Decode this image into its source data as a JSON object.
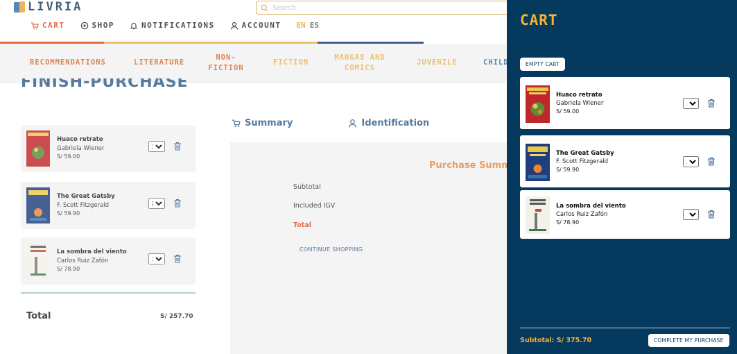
{
  "brand": {
    "logo_text": "LIVRIA"
  },
  "search": {
    "placeholder": "Search"
  },
  "nav": {
    "cart": "CART",
    "shop": "SHOP",
    "notifications": "NOTIFICATIONS",
    "account": "ACCOUNT",
    "lang_en": "EN",
    "lang_es": "ES"
  },
  "categories": [
    {
      "label": "RECOMMENDATIONS",
      "color": "#d9692a"
    },
    {
      "label": "LITERATURE",
      "color": "#d9692a"
    },
    {
      "label": "NON-\nFICTION",
      "color": "#d9692a"
    },
    {
      "label": "FICTION",
      "color": "#e8b24a"
    },
    {
      "label": "MANGAS AND\nCOMICS",
      "color": "#e8b24a"
    },
    {
      "label": "JUVENILE",
      "color": "#e8b24a"
    },
    {
      "label": "CHILDREN",
      "color": "#3a6f9e"
    }
  ],
  "checkout": {
    "title": "FINISH-PURCHASE",
    "items": [
      {
        "title": "Huaco retrato",
        "author": "Gabriela Wiener",
        "price": "S/ 59.00",
        "qty": "1"
      },
      {
        "title": "The Great Gatsby",
        "author": "F. Scott Fitzgerald",
        "price": "S/ 59.90",
        "qty": "2"
      },
      {
        "title": "La sombra del viento",
        "author": "Carlos Ruiz Zafón",
        "price": "S/ 78.90",
        "qty": "1"
      }
    ],
    "total_label": "Total",
    "total_value": "S/ 257.70",
    "tab_summary": "Summary",
    "tab_identification": "Identification",
    "summary_title": "Purchase Summary",
    "subtotal_label": "Subtotal",
    "igv_label": "Included IGV",
    "summary_total_label": "Total",
    "continue_shopping": "CONTINUE SHOPPING"
  },
  "cart": {
    "title": "CART",
    "empty_button": "EMPTY CART",
    "items": [
      {
        "title": "Huaco retrato",
        "author": "Gabriela Wiener",
        "price": "S/ 59.00",
        "qty": "3"
      },
      {
        "title": "The Great Gatsby",
        "author": "F. Scott Fitzgerald",
        "price": "S/ 59.90",
        "qty": "2"
      },
      {
        "title": "La sombra del viento",
        "author": "Carlos Ruiz Zafón",
        "price": "S/ 78.90",
        "qty": "1"
      }
    ],
    "subtotal": "Subtotal: S/ 375.70",
    "complete_button": "COMPLETE MY PURCHASE"
  },
  "colors": {
    "drawer_bg": "#053a5e",
    "accent_yellow": "#f4b531",
    "accent_orange": "#e34b1d",
    "brand_blue": "#2f5d8a"
  }
}
